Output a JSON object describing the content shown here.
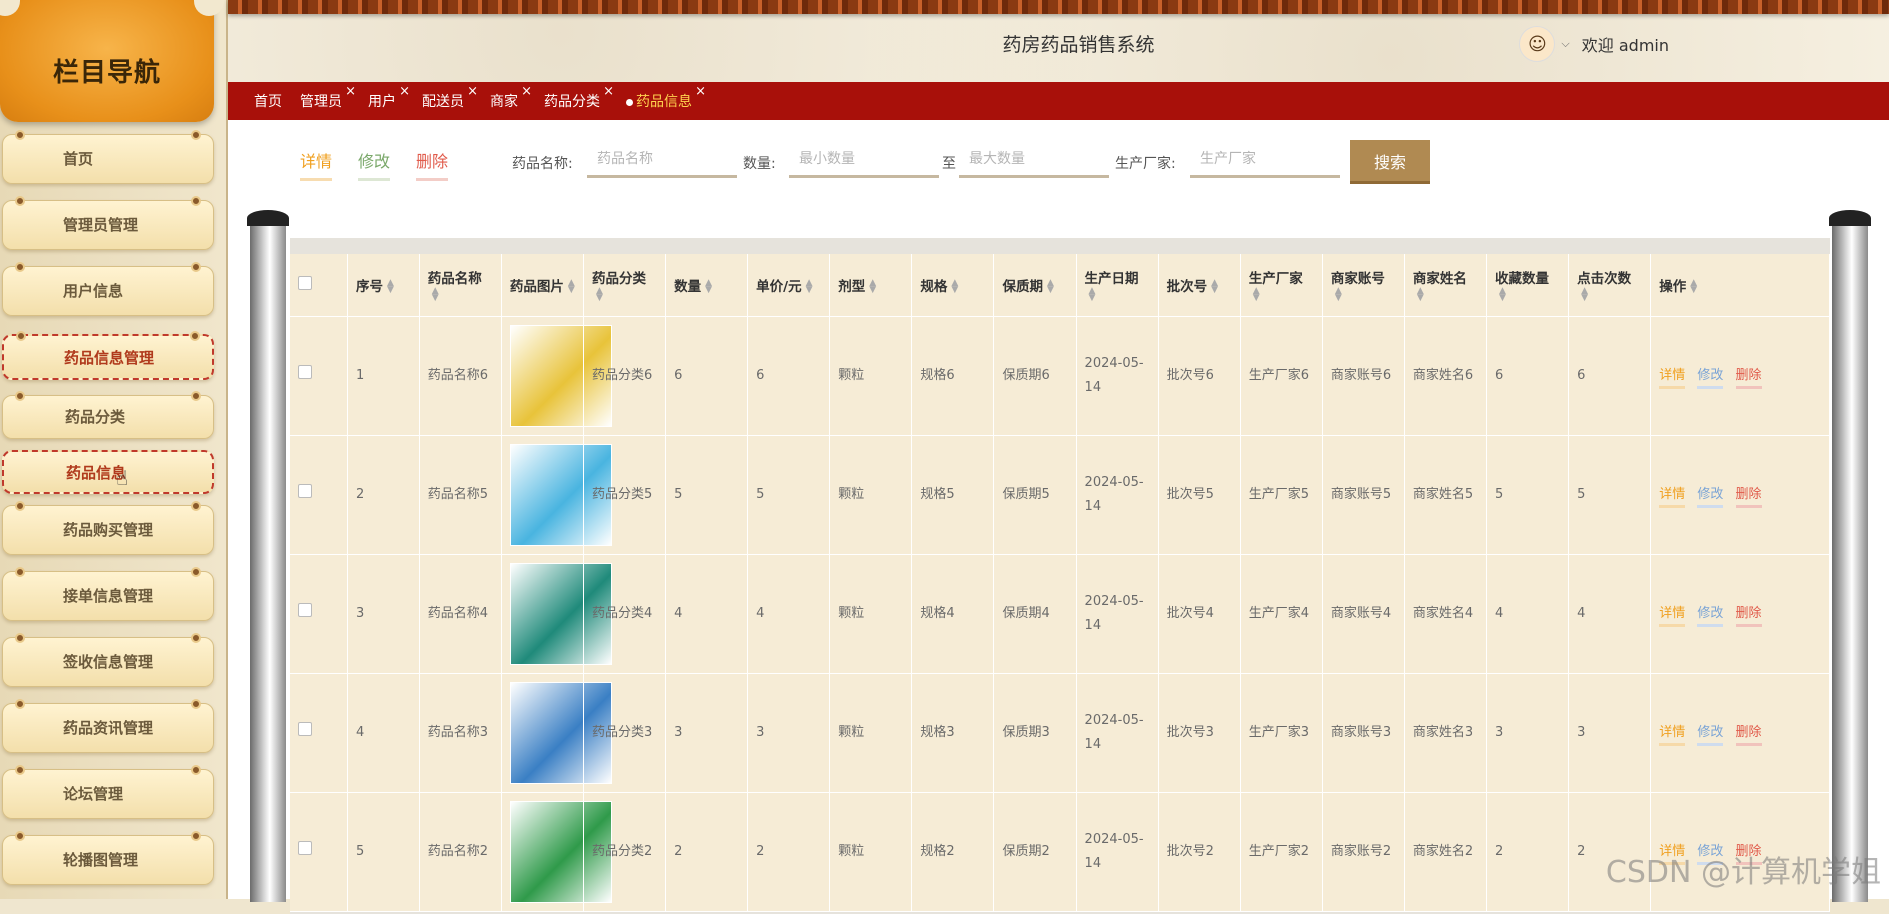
{
  "sidebar": {
    "title": "栏目导航",
    "items": [
      {
        "label": "首页"
      },
      {
        "label": "管理员管理"
      },
      {
        "label": "用户信息"
      },
      {
        "label": "药品信息管理"
      },
      {
        "label": "药品分类"
      },
      {
        "label": "药品信息"
      },
      {
        "label": "药品购买管理"
      },
      {
        "label": "接单信息管理"
      },
      {
        "label": "签收信息管理"
      },
      {
        "label": "药品资讯管理"
      },
      {
        "label": "论坛管理"
      },
      {
        "label": "轮播图管理"
      }
    ]
  },
  "header": {
    "title": "药房药品销售系统",
    "welcome": "欢迎 admin"
  },
  "tabs": [
    {
      "label": "首页"
    },
    {
      "label": "管理员"
    },
    {
      "label": "用户"
    },
    {
      "label": "配送员"
    },
    {
      "label": "商家"
    },
    {
      "label": "药品分类"
    },
    {
      "label": "药品信息"
    }
  ],
  "toolbar": {
    "detail": "详情",
    "edit": "修改",
    "delete": "删除",
    "name_label": "药品名称:",
    "name_placeholder": "药品名称",
    "qty_label": "数量:",
    "qty_min_placeholder": "最小数量",
    "qty_to": "至",
    "qty_max_placeholder": "最大数量",
    "maker_label": "生产厂家:",
    "maker_placeholder": "生产厂家",
    "search": "搜索"
  },
  "table": {
    "headers": [
      "序号",
      "药品名称",
      "药品图片",
      "药品分类",
      "数量",
      "单价/元",
      "剂型",
      "规格",
      "保质期",
      "生产日期",
      "批次号",
      "生产厂家",
      "商家账号",
      "商家姓名",
      "收藏数量",
      "点击次数",
      "操作"
    ],
    "rows": [
      {
        "no": "1",
        "name": "药品名称6",
        "cat": "药品分类6",
        "qty": "6",
        "price": "6",
        "form": "颗粒",
        "spec": "规格6",
        "shelf": "保质期6",
        "date": "2024-05-14",
        "batch": "批次号6",
        "maker": "生产厂家6",
        "acct": "商家账号6",
        "mname": "商家姓名6",
        "fav": "6",
        "clicks": "6",
        "img_color": "#e8c33a"
      },
      {
        "no": "2",
        "name": "药品名称5",
        "cat": "药品分类5",
        "qty": "5",
        "price": "5",
        "form": "颗粒",
        "spec": "规格5",
        "shelf": "保质期5",
        "date": "2024-05-14",
        "batch": "批次号5",
        "maker": "生产厂家5",
        "acct": "商家账号5",
        "mname": "商家姓名5",
        "fav": "5",
        "clicks": "5",
        "img_color": "#49b4e0"
      },
      {
        "no": "3",
        "name": "药品名称4",
        "cat": "药品分类4",
        "qty": "4",
        "price": "4",
        "form": "颗粒",
        "spec": "规格4",
        "shelf": "保质期4",
        "date": "2024-05-14",
        "batch": "批次号4",
        "maker": "生产厂家4",
        "acct": "商家账号4",
        "mname": "商家姓名4",
        "fav": "4",
        "clicks": "4",
        "img_color": "#1f8a7a"
      },
      {
        "no": "4",
        "name": "药品名称3",
        "cat": "药品分类3",
        "qty": "3",
        "price": "3",
        "form": "颗粒",
        "spec": "规格3",
        "shelf": "保质期3",
        "date": "2024-05-14",
        "batch": "批次号3",
        "maker": "生产厂家3",
        "acct": "商家账号3",
        "mname": "商家姓名3",
        "fav": "3",
        "clicks": "3",
        "img_color": "#3a7fc4"
      },
      {
        "no": "5",
        "name": "药品名称2",
        "cat": "药品分类2",
        "qty": "2",
        "price": "2",
        "form": "颗粒",
        "spec": "规格2",
        "shelf": "保质期2",
        "date": "2024-05-14",
        "batch": "批次号2",
        "maker": "生产厂家2",
        "acct": "商家账号2",
        "mname": "商家姓名2",
        "fav": "2",
        "clicks": "2",
        "img_color": "#2f9a4a"
      }
    ],
    "ops": {
      "detail": "详情",
      "edit": "修改",
      "delete": "删除"
    }
  },
  "watermark": "CSDN @计算机学姐"
}
